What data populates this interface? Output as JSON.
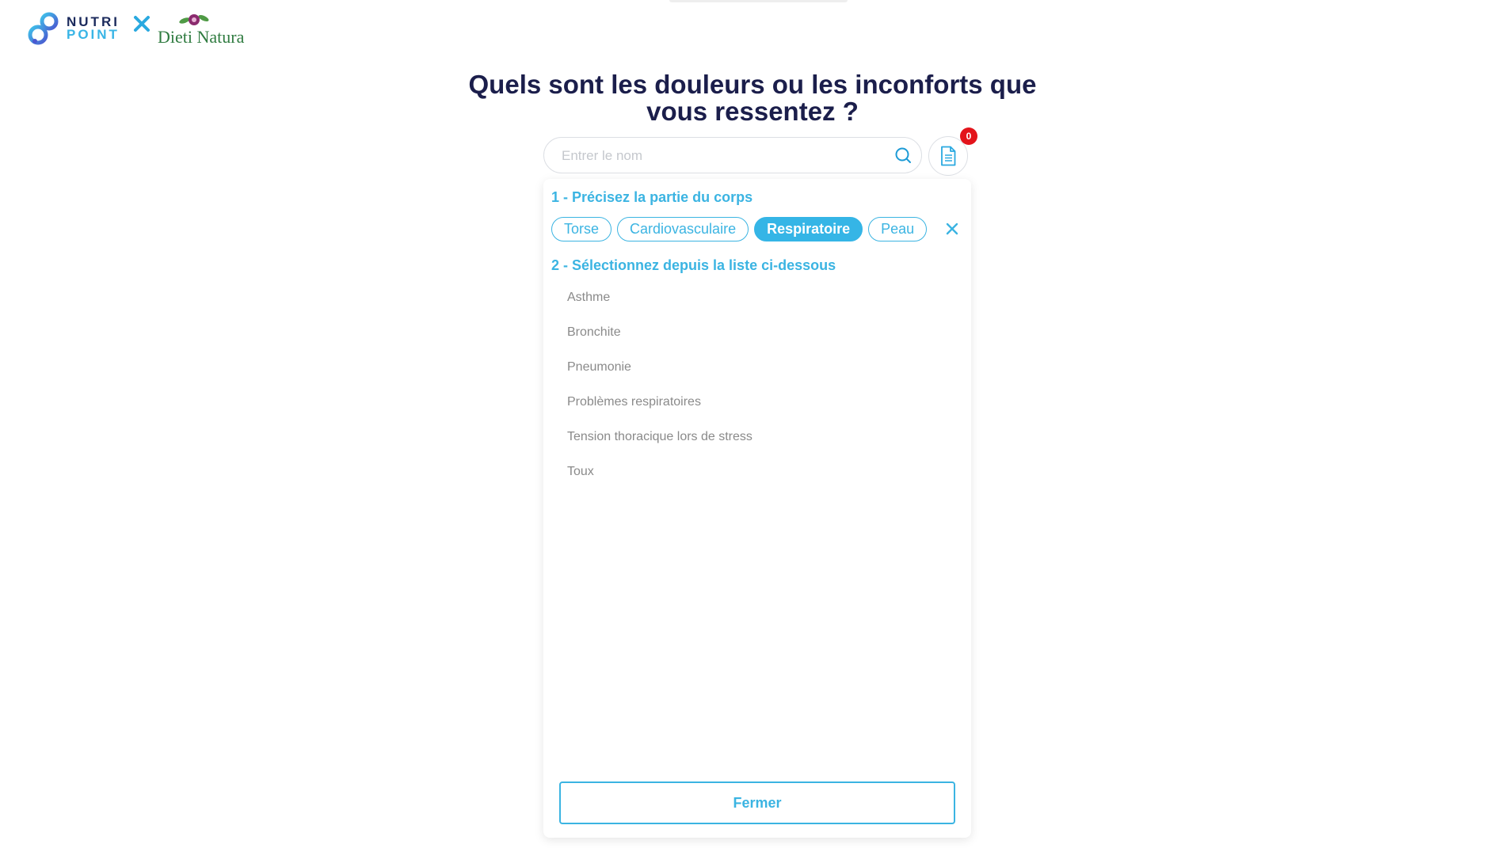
{
  "brand": {
    "nutripoint_line1": "NUTRI",
    "nutripoint_line2": "POINT",
    "partner": "Dieti Natura"
  },
  "page_title": "Quels sont les douleurs ou les inconforts que vous ressentez ?",
  "search": {
    "placeholder": "Entrer le nom",
    "value": ""
  },
  "selection_badge": "0",
  "step1_label": "1 - Précisez la partie du corps",
  "body_parts": [
    {
      "label": "Torse",
      "active": false
    },
    {
      "label": "Cardiovasculaire",
      "active": false
    },
    {
      "label": "Respiratoire",
      "active": true
    },
    {
      "label": "Peau",
      "active": false
    }
  ],
  "step2_label": "2 - Sélectionnez depuis la liste ci-dessous",
  "conditions": [
    "Asthme",
    "Bronchite",
    "Pneumonie",
    "Problèmes respiratoires",
    "Tension thoracique lors de stress",
    "Toux"
  ],
  "close_label": "Fermer",
  "colors": {
    "accent": "#3bb4e2",
    "title": "#1b1e4b",
    "badge": "#e3141b",
    "list_text": "#8a8a8a"
  },
  "icons": {
    "search": "search-icon",
    "document": "document-icon",
    "clear": "close-icon"
  }
}
